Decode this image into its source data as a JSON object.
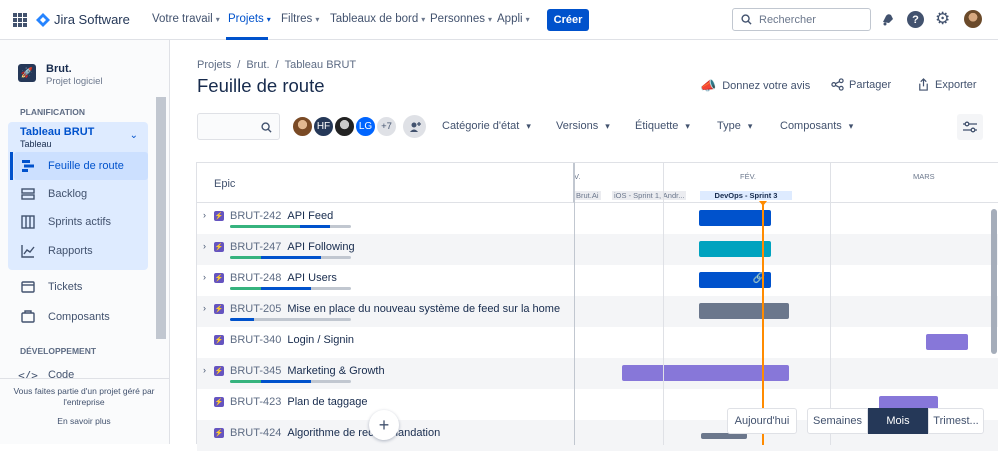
{
  "nav": {
    "app_name": "Jira Software",
    "items": [
      "Votre travail",
      "Projets",
      "Filtres",
      "Tableaux de bord",
      "Personnes",
      "Appli"
    ],
    "create_label": "Créer",
    "search_placeholder": "Rechercher"
  },
  "sidebar": {
    "project_name": "Brut.",
    "project_type": "Projet logiciel",
    "planning_heading": "PLANIFICATION",
    "board_name": "Tableau BRUT",
    "board_type": "Tableau",
    "items": [
      "Feuille de route",
      "Backlog",
      "Sprints actifs",
      "Rapports",
      "Tickets",
      "Composants"
    ],
    "dev_heading": "DÉVELOPPEMENT",
    "code_label": "Code",
    "footer_text": "Vous faites partie d'un projet géré par l'entreprise",
    "learn_more": "En savoir plus"
  },
  "breadcrumb": {
    "projects": "Projets",
    "project": "Brut.",
    "board": "Tableau BRUT",
    "sep": "/"
  },
  "page": {
    "title": "Feuille de route",
    "feedback": "Donnez votre avis",
    "share": "Partager",
    "export": "Exporter"
  },
  "filters": {
    "avatars": [
      "HF",
      "LG"
    ],
    "more": "+7",
    "items": [
      "Catégorie d'état",
      "Versions",
      "Étiquette",
      "Type",
      "Composants"
    ]
  },
  "timeline": {
    "epic_header": "Epic",
    "months": [
      "V.",
      "FÉV.",
      "MARS"
    ],
    "sprints": [
      "Brut.Ai",
      "iOS - Sprint 1, Andr...",
      "DevOps - Sprint 3"
    ]
  },
  "epics": [
    {
      "key": "BRUT-242",
      "title": "API Feed",
      "expandable": true,
      "done": 0.58,
      "inprog": 0.25
    },
    {
      "key": "BRUT-247",
      "title": "API Following",
      "expandable": true,
      "done": 0.26,
      "inprog": 0.49
    },
    {
      "key": "BRUT-248",
      "title": "API Users",
      "expandable": true,
      "done": 0.26,
      "inprog": 0.41
    },
    {
      "key": "BRUT-205",
      "title": "Mise en place du nouveau système de feed sur la home",
      "expandable": true,
      "done": 0.0,
      "inprog": 0.2
    },
    {
      "key": "BRUT-340",
      "title": "Login / Signin",
      "expandable": false,
      "done": 0,
      "inprog": 0
    },
    {
      "key": "BRUT-345",
      "title": "Marketing & Growth",
      "expandable": true,
      "done": 0.26,
      "inprog": 0.41
    },
    {
      "key": "BRUT-423",
      "title": "Plan de taggage",
      "expandable": false,
      "done": 0,
      "inprog": 0
    },
    {
      "key": "BRUT-424",
      "title": "Algorithme de recommandation",
      "expandable": false,
      "done": 0,
      "inprog": 0
    }
  ],
  "colors": {
    "blue": "#0052cc",
    "teal": "#00a3bf",
    "gray": "#6b778c",
    "purple": "#8777d9",
    "today": "#ff8b00"
  },
  "controls": {
    "today": "Aujourd'hui",
    "weeks": "Semaines",
    "months": "Mois",
    "quarters": "Trimest...",
    "add": "+"
  }
}
